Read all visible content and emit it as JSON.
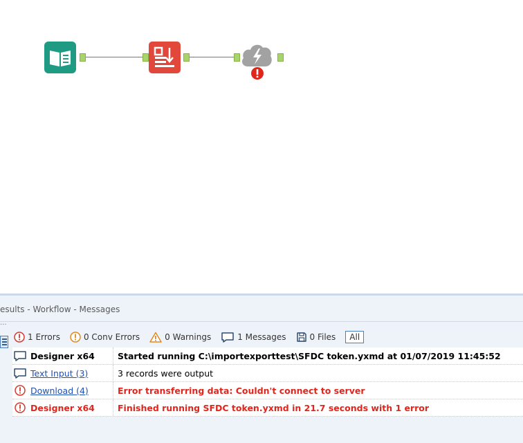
{
  "results": {
    "title": "esults - Workflow - Messages",
    "filters": [
      {
        "label": "1 Errors",
        "icon": "error-circle-icon"
      },
      {
        "label": "0 Conv Errors",
        "icon": "conv-error-circle-icon"
      },
      {
        "label": "0 Warnings",
        "icon": "warning-triangle-icon"
      },
      {
        "label": "1 Messages",
        "icon": "message-bubble-icon"
      },
      {
        "label": "0 Files",
        "icon": "file-save-icon"
      }
    ],
    "all_label": "All",
    "messages": [
      {
        "type": "message",
        "source": "Designer x64",
        "text": "Started running C:\\importexporttest\\SFDC token.yxmd at 01/07/2019 11:45:52"
      },
      {
        "type": "message",
        "source": "Text Input (3)",
        "text": "3 records were output"
      },
      {
        "type": "error",
        "source": "Download (4)",
        "text": "Error transferring data: Couldn't connect to server"
      },
      {
        "type": "error",
        "source": "Designer x64",
        "text": "Finished running SFDC token.yxmd in 21.7 seconds with 1 error"
      }
    ]
  },
  "colors": {
    "error": "#e0261c",
    "link": "#1f4fb3",
    "text_input_tool": "#1f9a83",
    "download_tool": "#e2473b",
    "connector_tool": "#9a9a9a",
    "anchor": "#a9d46b"
  },
  "canvas": {
    "tools": [
      {
        "name": "Text Input",
        "icon": "book-icon"
      },
      {
        "name": "Download",
        "icon": "download-icon"
      },
      {
        "name": "Connector",
        "icon": "cloud-lightning-icon",
        "status": "error"
      }
    ]
  }
}
